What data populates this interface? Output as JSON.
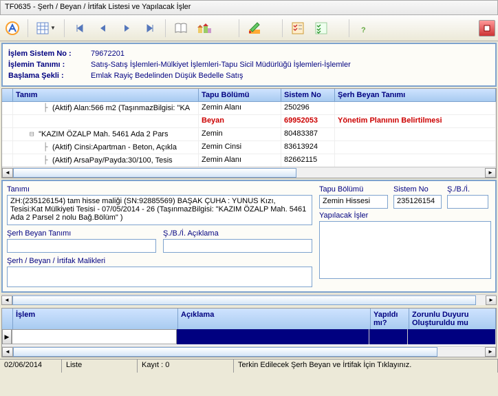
{
  "titlebar": "TF0635 - Şerh / Beyan / İrtifak Listesi ve Yapılacak İşler",
  "info": {
    "sistem_no_label": "İşlem Sistem No :",
    "sistem_no": "79672201",
    "tanim_label": "İşlemin Tanımı :",
    "tanim": "Satış-Satış İşlemleri-Mülkiyet İşlemleri-Tapu Sicil Müdürlüğü İşlemleri-İşlemler",
    "baslama_label": "Başlama Şekli :",
    "baslama": "Emlak Rayiç Bedelinden Düşük Bedelle Satış"
  },
  "grid": {
    "headers": {
      "tanim": "Tanım",
      "tapu": "Tapu Bölümü",
      "sistem": "Sistem No",
      "serh": "Şerh Beyan Tanımı"
    },
    "rows": [
      {
        "indent": 2,
        "icon": "leaf",
        "tanim": "(Aktif) Alan:566 m2 (TaşınmazBilgisi: \"KA",
        "tapu": "Zemin Alanı",
        "sistem": "250296",
        "serh": "",
        "red": false
      },
      {
        "indent": 2,
        "icon": "none",
        "tanim": "",
        "tapu": "Beyan",
        "sistem": "69952053",
        "serh": "Yönetim Planının Belirtilmesi",
        "red": true
      },
      {
        "indent": 1,
        "icon": "branch",
        "tanim": "\"KAZIM ÖZALP Mah. 5461 Ada 2 Pars",
        "tapu": "Zemin",
        "sistem": "80483387",
        "serh": "",
        "red": false
      },
      {
        "indent": 2,
        "icon": "leaf",
        "tanim": "(Aktif) Cinsi:Apartman - Beton, Açıkla",
        "tapu": "Zemin Cinsi",
        "sistem": "83613924",
        "serh": "",
        "red": false
      },
      {
        "indent": 2,
        "icon": "leaf",
        "tanim": "(Aktif) ArsaPay/Payda:30/100, Tesis",
        "tapu": "Zemin Alanı",
        "sistem": "82662115",
        "serh": "",
        "red": false
      }
    ]
  },
  "details": {
    "tanimi_label": "Tanımı",
    "tanimi_text": "ZH:(235126154) tam hisse maliği (SN:92885569) BAŞAK ÇUHA : YUNUS Kızı,  Tesisi:Kat Mülkiyeti Tesisi - 07/05/2014 - 26 (TaşınmazBilgisi: \"KAZIM ÖZALP Mah. 5461 Ada 2 Parsel 2 nolu Bağ.Bölüm\" )",
    "tapu_label": "Tapu Bölümü",
    "tapu_value": "Zemin Hissesi",
    "sistemno_label": "Sistem No",
    "sistemno_value": "235126154",
    "sbi_label": "Ş./B./İ.",
    "sbi_value": "",
    "yapilacak_label": "Yapılacak İşler",
    "serh_beyan_label": "Şerh Beyan Tanımı",
    "sbi_aciklama_label": "Ş./B./İ. Açıklama",
    "malikler_label": "Şerh / Beyan / İrtifak Malikleri"
  },
  "bottom_grid": {
    "headers": {
      "islem": "İşlem",
      "aciklama": "Açıklama",
      "yapildi": "Yapıldı mı?",
      "zorunlu": "Zorunlu Duyuru Oluşturuldu mu"
    }
  },
  "status": {
    "date": "02/06/2014",
    "liste": "Liste",
    "kayit": "Kayıt : 0",
    "hint": "Terkin Edilecek Şerh Beyan ve İrtifak İçin Tıklayınız."
  }
}
